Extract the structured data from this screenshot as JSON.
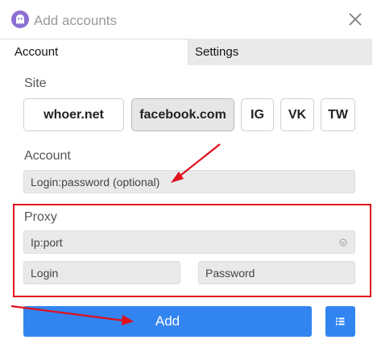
{
  "window": {
    "title": "Add accounts"
  },
  "tabs": [
    {
      "label": "Account",
      "active": true
    },
    {
      "label": "Settings",
      "active": false
    }
  ],
  "site": {
    "label": "Site",
    "options": [
      {
        "label": "whoer.net",
        "selected": false
      },
      {
        "label": "facebook.com",
        "selected": true
      },
      {
        "label": "IG",
        "selected": false
      },
      {
        "label": "VK",
        "selected": false
      },
      {
        "label": "TW",
        "selected": false
      }
    ]
  },
  "account": {
    "label": "Account",
    "placeholder": "Login:password (optional)"
  },
  "proxy": {
    "label": "Proxy",
    "address_placeholder": "Ip:port",
    "login_placeholder": "Login",
    "password_placeholder": "Password"
  },
  "actions": {
    "add_label": "Add"
  },
  "colors": {
    "accent": "#3285f0",
    "annotation": "#e0101b",
    "brand": "#8b6fd1"
  },
  "icons": {
    "app": "ghost-icon",
    "close": "close-icon",
    "dropdown": "chevron-down-icon",
    "menu": "list-icon"
  }
}
